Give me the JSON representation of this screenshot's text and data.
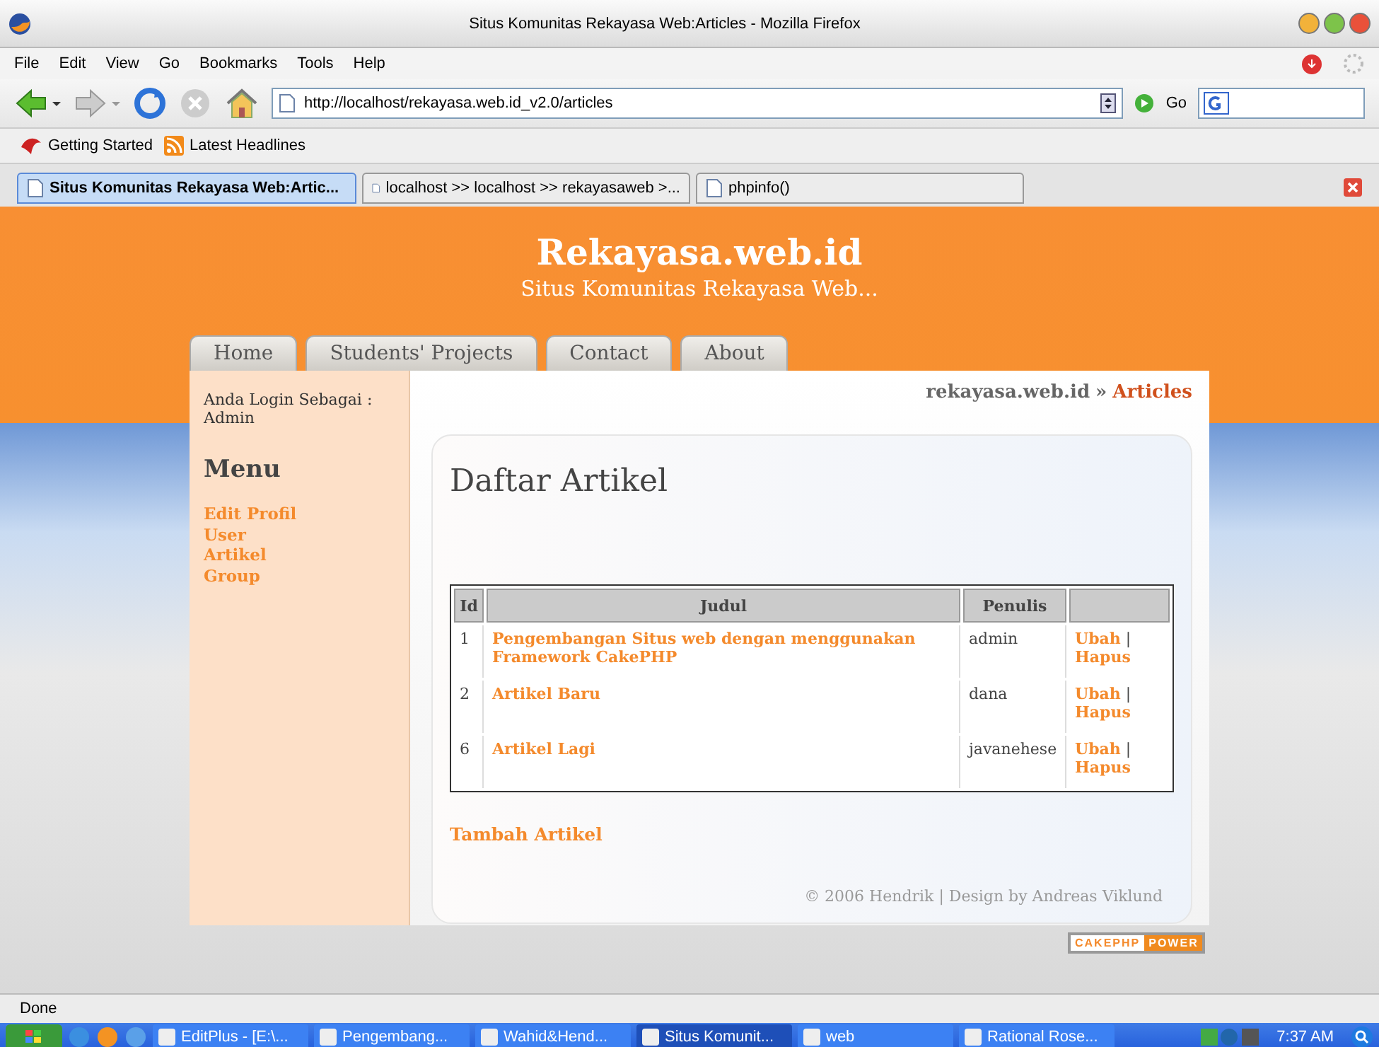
{
  "window": {
    "title": "Situs Komunitas Rekayasa Web:Articles - Mozilla Firefox"
  },
  "menu": [
    "File",
    "Edit",
    "View",
    "Go",
    "Bookmarks",
    "Tools",
    "Help"
  ],
  "toolbar": {
    "url": "http://localhost/rekayasa.web.id_v2.0/articles",
    "go_label": "Go"
  },
  "bookmarks": [
    "Getting Started",
    "Latest Headlines"
  ],
  "tabs": [
    {
      "label": "Situs Komunitas Rekayasa Web:Artic...",
      "selected": true
    },
    {
      "label": "localhost >> localhost >> rekayasaweb  >...",
      "selected": false
    },
    {
      "label": "phpinfo()",
      "selected": false
    }
  ],
  "page": {
    "site_title": "Rekayasa.web.id",
    "tagline": "Situs Komunitas Rekayasa Web...",
    "nav": [
      "Home",
      "Students' Projects",
      "Contact",
      "About"
    ],
    "login_label": "Anda Login Sebagai :",
    "login_user": "Admin",
    "menu_heading": "Menu",
    "menu_items": [
      "Edit Profil",
      "User",
      "Artikel",
      "Group"
    ],
    "breadcrumb": {
      "home": "rekayasa.web.id",
      "separator": "»",
      "current": "Articles"
    },
    "heading": "Daftar Artikel",
    "table": {
      "columns": [
        "Id",
        "Judul",
        "Penulis"
      ],
      "rows": [
        {
          "id": "1",
          "title": "Pengembangan Situs web dengan menggunakan Framework CakePHP",
          "author": "admin",
          "edit": "Ubah",
          "separator": "|",
          "delete": "Hapus"
        },
        {
          "id": "2",
          "title": "Artikel Baru",
          "author": "dana",
          "edit": "Ubah",
          "separator": "|",
          "delete": "Hapus"
        },
        {
          "id": "6",
          "title": "Artikel Lagi",
          "author": "javanehese",
          "edit": "Ubah",
          "separator": "|",
          "delete": "Hapus"
        }
      ]
    },
    "add_link": "Tambah Artikel",
    "footer": "© 2006 Hendrik | Design by Andreas Viklund",
    "badge": {
      "left": "CAKEPHP",
      "right": "POWER"
    }
  },
  "status_bar": "Done",
  "taskbar": {
    "tasks": [
      {
        "label": "EditPlus - [E:\\...",
        "selected": false
      },
      {
        "label": "Pengembang...",
        "selected": false
      },
      {
        "label": "Wahid&Hend...",
        "selected": false
      },
      {
        "label": "Situs Komunit...",
        "selected": true
      },
      {
        "label": "web",
        "selected": false
      },
      {
        "label": "Rational Rose...",
        "selected": false
      }
    ],
    "clock": "7:37 AM"
  }
}
